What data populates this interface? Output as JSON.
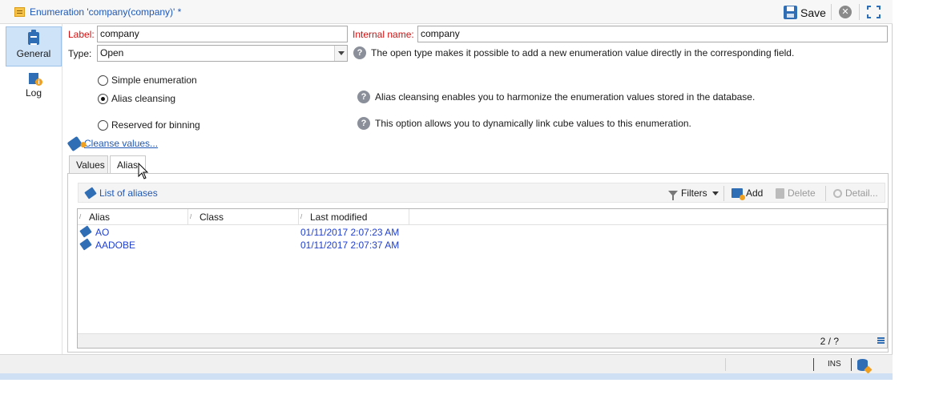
{
  "window": {
    "title": "Enumeration 'company(company)' *",
    "save_label": "Save"
  },
  "leftnav": {
    "items": [
      {
        "label": "General",
        "icon": "clipboard-icon",
        "active": true
      },
      {
        "label": "Log",
        "icon": "log-icon",
        "active": false
      }
    ]
  },
  "form": {
    "label_caption": "Label:",
    "label_value": "company",
    "internal_name_caption": "Internal name:",
    "internal_name_value": "company",
    "type_caption": "Type:",
    "type_value": "Open",
    "type_help": "The open type makes it possible to add a new enumeration value directly in the corresponding field.",
    "radio_options": [
      {
        "label": "Simple enumeration",
        "checked": false
      },
      {
        "label": "Alias cleansing",
        "checked": true
      },
      {
        "label": "Reserved for binning",
        "checked": false
      }
    ],
    "alias_help": "Alias cleansing enables you to harmonize the enumeration values stored in the database.",
    "binning_help": "This option allows you to dynamically link cube values to this enumeration.",
    "cleanse_link": "Cleanse values..."
  },
  "tabs": [
    {
      "label": "Values",
      "active": false
    },
    {
      "label": "Alias",
      "active": true
    }
  ],
  "alias_panel": {
    "list_title": "List of aliases",
    "filters_label": "Filters",
    "add_label": "Add",
    "delete_label": "Delete",
    "detail_label": "Detail...",
    "columns": [
      "Alias",
      "Class",
      "Last modified"
    ],
    "rows": [
      {
        "alias": "AO",
        "class": "",
        "last_modified": "01/11/2017 2:07:23 AM"
      },
      {
        "alias": "AADOBE",
        "class": "",
        "last_modified": "01/11/2017 2:07:37 AM"
      }
    ],
    "count": "2 / ?"
  },
  "statusbar": {
    "ins": "INS"
  },
  "colors": {
    "accent_blue": "#1f58b5",
    "required_red": "#d01010",
    "selected_nav": "#cfe3f8"
  }
}
